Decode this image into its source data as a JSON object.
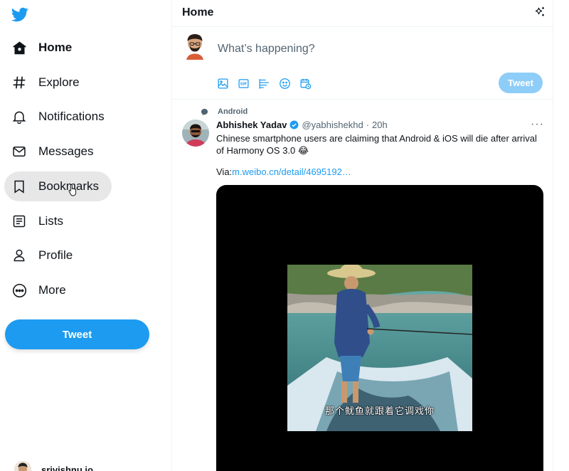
{
  "sidebar": {
    "items": [
      {
        "label": "Home",
        "icon": "home-icon"
      },
      {
        "label": "Explore",
        "icon": "hashtag-icon"
      },
      {
        "label": "Notifications",
        "icon": "bell-icon"
      },
      {
        "label": "Messages",
        "icon": "envelope-icon"
      },
      {
        "label": "Bookmarks",
        "icon": "bookmark-icon"
      },
      {
        "label": "Lists",
        "icon": "list-icon"
      },
      {
        "label": "Profile",
        "icon": "person-icon"
      },
      {
        "label": "More",
        "icon": "more-circle-icon"
      }
    ],
    "active": "Home",
    "hovered": "Bookmarks",
    "tweet_button": "Tweet",
    "account_name": "srivishnu.io"
  },
  "header": {
    "title": "Home"
  },
  "composer": {
    "placeholder": "What’s happening?",
    "tools": [
      "image-icon",
      "gif-icon",
      "poll-icon",
      "emoji-icon",
      "schedule-icon"
    ],
    "tweet_button": "Tweet"
  },
  "tweet": {
    "context": "Android",
    "author_name": "Abhishek Yadav",
    "handle": "@yabhishekhd",
    "separator": "·",
    "time": "20h",
    "more": "···",
    "text": "Chinese smartphone users are claiming that Android & iOS will die after arrival of Harmony OS 3.0 😂",
    "via_label": "Via:",
    "link": "m.weibo.cn/detail/4695192…",
    "video_subtitle": "那个鱿鱼就跟着它调戏你"
  },
  "colors": {
    "accent": "#1d9bf0",
    "accent_disabled": "#8ecdf8",
    "text": "#0f1419",
    "muted": "#536471",
    "hover": "#e7e7e8"
  }
}
